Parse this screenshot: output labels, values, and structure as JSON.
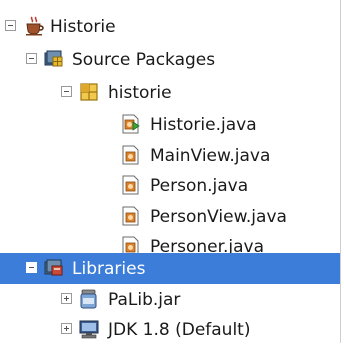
{
  "tree": {
    "nodes": [
      {
        "label": "Historie",
        "icon": "project-coffee-cup-icon"
      },
      {
        "label": "Source Packages",
        "icon": "source-packages-icon"
      },
      {
        "label": "historie",
        "icon": "package-icon"
      },
      {
        "label": "Historie.java",
        "icon": "main-class-java-file-icon"
      },
      {
        "label": "MainView.java",
        "icon": "java-file-icon"
      },
      {
        "label": "Person.java",
        "icon": "java-file-icon"
      },
      {
        "label": "PersonView.java",
        "icon": "java-file-icon"
      },
      {
        "label": "Personer.java",
        "icon": "java-file-icon"
      },
      {
        "label": "Libraries",
        "icon": "libraries-icon"
      },
      {
        "label": "PaLib.jar",
        "icon": "jar-file-icon"
      },
      {
        "label": "JDK 1.8 (Default)",
        "icon": "jdk-platform-icon"
      }
    ],
    "selected_label": "Libraries"
  },
  "colors": {
    "selection": "#3b7dd8",
    "package_yellow": "#e8b92f",
    "java_orange": "#d9822b"
  }
}
